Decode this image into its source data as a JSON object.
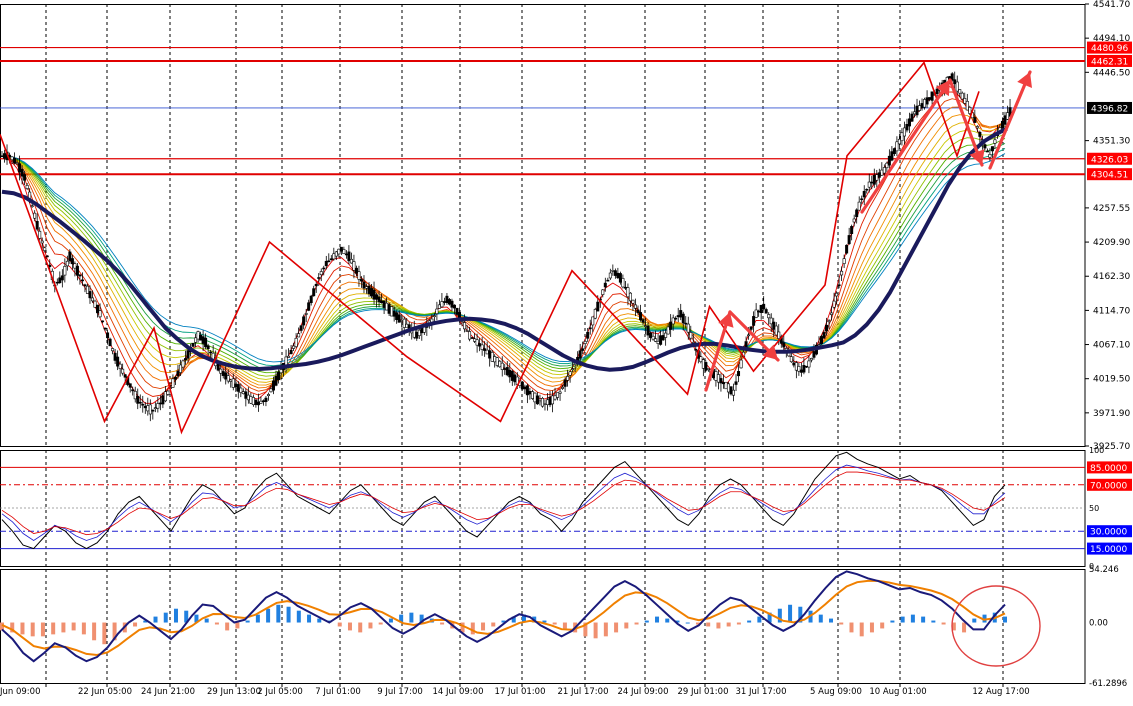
{
  "colors": {
    "background": "#ffffff",
    "plot_background": "#ffffff",
    "grid": "#000000",
    "candles": "#000000",
    "wma_fan_from": "#c00000",
    "wma_fan_to": "#00a040",
    "main_ma": "#1a1a5c",
    "red_annotations": "#e00000",
    "arrow": "#f04040",
    "level_lines": "#e00000",
    "current_price_line": "#3050d0",
    "macd_hist_pos": "#2080e0",
    "macd_hist_neg": "#f09070",
    "macd_line": "#1a1a7a",
    "signal_line": "#f08000",
    "oscillator_main": "#000000",
    "oscillator_blue": "#2020d0",
    "oscillator_red": "#e00000",
    "label_bg_red": "#ff0000",
    "label_bg_blue": "#0000ff",
    "label_bg_black": "#000000",
    "label_text": "#ffffff",
    "circle": "#e04040"
  },
  "chart_data": [
    {
      "panel": "price",
      "type": "candlestick",
      "ylim": [
        3925.7,
        4541.7
      ],
      "y_ticks": [
        "4541.70",
        "4494.10",
        "4446.50",
        "4351.30",
        "4257.55",
        "4209.90",
        "4162.30",
        "4114.70",
        "4067.10",
        "4019.50",
        "3971.90",
        "3925.70"
      ],
      "y_tick_values": [
        4541.7,
        4494.1,
        4446.5,
        4351.3,
        4257.55,
        4209.9,
        4162.3,
        4114.7,
        4067.1,
        4019.5,
        3971.9,
        3925.7
      ],
      "price_labels": [
        {
          "text": "4480.96",
          "value": 4480.96,
          "style": "red"
        },
        {
          "text": "4462.31",
          "value": 4462.31,
          "style": "red"
        },
        {
          "text": "4396.82",
          "value": 4396.82,
          "style": "black"
        },
        {
          "text": "4326.03",
          "value": 4326.03,
          "style": "red"
        },
        {
          "text": "4304.51",
          "value": 4304.51,
          "style": "red"
        }
      ],
      "horizontal_levels": [
        4480.96,
        4462.31,
        4326.03,
        4304.51
      ],
      "current_price": 4396.82,
      "close_path": [
        4330,
        4320,
        4300,
        4260,
        4220,
        4190,
        4150,
        4160,
        4190,
        4170,
        4150,
        4130,
        4110,
        4080,
        4050,
        4030,
        4010,
        3990,
        3980,
        3975,
        3985,
        4000,
        4020,
        4040,
        4060,
        4080,
        4070,
        4050,
        4030,
        4020,
        4010,
        4000,
        3990,
        3985,
        3990,
        4010,
        4030,
        4050,
        4070,
        4100,
        4130,
        4160,
        4180,
        4190,
        4200,
        4190,
        4170,
        4150,
        4140,
        4130,
        4120,
        4110,
        4100,
        4090,
        4080,
        4090,
        4100,
        4120,
        4130,
        4120,
        4100,
        4080,
        4070,
        4060,
        4050,
        4040,
        4030,
        4020,
        4010,
        4000,
        3990,
        3985,
        3990,
        4000,
        4020,
        4040,
        4060,
        4090,
        4120,
        4150,
        4170,
        4160,
        4140,
        4120,
        4100,
        4080,
        4070,
        4080,
        4100,
        4110,
        4090,
        4060,
        4040,
        4030,
        4020,
        4010,
        4000,
        4040,
        4080,
        4110,
        4120,
        4100,
        4080,
        4060,
        4040,
        4030,
        4040,
        4060,
        4080,
        4110,
        4150,
        4200,
        4240,
        4270,
        4290,
        4300,
        4310,
        4330,
        4350,
        4370,
        4390,
        4400,
        4410,
        4420,
        4430,
        4440,
        4420,
        4400,
        4380,
        4350,
        4330,
        4360,
        4380,
        4396.82
      ],
      "main_ma": [
        4280,
        4278,
        4272,
        4262,
        4250,
        4238,
        4225,
        4212,
        4198,
        4184,
        4168,
        4150,
        4130,
        4110,
        4090,
        4075,
        4062,
        4052,
        4045,
        4040,
        4036,
        4034,
        4033,
        4034,
        4036,
        4038,
        4040,
        4043,
        4047,
        4052,
        4058,
        4064,
        4070,
        4076,
        4082,
        4088,
        4093,
        4097,
        4100,
        4102,
        4103,
        4102,
        4100,
        4096,
        4090,
        4082,
        4072,
        4062,
        4052,
        4044,
        4038,
        4034,
        4032,
        4033,
        4036,
        4042,
        4049,
        4056,
        4062,
        4066,
        4068,
        4068,
        4066,
        4063,
        4060,
        4058,
        4057,
        4057,
        4058,
        4060,
        4063,
        4066,
        4070,
        4080,
        4095,
        4115,
        4140,
        4170,
        4200,
        4230,
        4260,
        4290,
        4315,
        4335,
        4350,
        4360,
        4368
      ],
      "x_labels": [
        "Jun 09:00",
        "22 Jun 05:00",
        "24 Jun 21:00",
        "29 Jun 13:00",
        "2 Jul 05:00",
        "7 Jul 01:00",
        "9 Jul 17:00",
        "14 Jul 09:00",
        "17 Jul 01:00",
        "21 Jul 17:00",
        "24 Jul 09:00",
        "29 Jul 01:00",
        "31 Jul 17:00",
        "5 Aug 09:00",
        "10 Aug 01:00",
        "12 Aug 17:00"
      ],
      "zigzag": [
        [
          0,
          4360
        ],
        [
          0.095,
          3960
        ],
        [
          0.14,
          4090
        ],
        [
          0.165,
          3945
        ],
        [
          0.245,
          4210
        ],
        [
          0.37,
          4050
        ],
        [
          0.455,
          3960
        ],
        [
          0.52,
          4170
        ],
        [
          0.625,
          3998
        ],
        [
          0.645,
          4120
        ],
        [
          0.685,
          4030
        ],
        [
          0.75,
          4150
        ],
        [
          0.77,
          4330
        ],
        [
          0.84,
          4460
        ],
        [
          0.87,
          4330
        ],
        [
          0.89,
          4420
        ]
      ]
    },
    {
      "panel": "oscillator",
      "type": "line",
      "ylim": [
        0,
        100
      ],
      "y_ticks": [
        "100",
        "50",
        "0"
      ],
      "y_tick_values": [
        100,
        50,
        0
      ],
      "level_labels": [
        {
          "text": "85.0000",
          "value": 85,
          "style": "red"
        },
        {
          "text": "70.0000",
          "value": 70,
          "style": "red"
        },
        {
          "text": "30.0000",
          "value": 30,
          "style": "blue"
        },
        {
          "text": "15.0000",
          "value": 15,
          "style": "blue"
        }
      ],
      "series": [
        {
          "values": [
            40,
            30,
            18,
            15,
            25,
            35,
            30,
            20,
            15,
            20,
            30,
            45,
            55,
            60,
            50,
            40,
            30,
            45,
            60,
            70,
            65,
            55,
            45,
            50,
            65,
            75,
            80,
            70,
            60,
            55,
            50,
            45,
            55,
            65,
            70,
            60,
            50,
            40,
            35,
            45,
            55,
            60,
            50,
            40,
            30,
            25,
            35,
            45,
            55,
            60,
            55,
            45,
            40,
            30,
            40,
            55,
            65,
            75,
            85,
            90,
            80,
            70,
            60,
            50,
            40,
            35,
            45,
            60,
            70,
            75,
            70,
            60,
            50,
            40,
            35,
            45,
            60,
            75,
            85,
            95,
            98,
            92,
            88,
            85,
            80,
            75,
            78,
            72,
            70,
            65,
            55,
            45,
            35,
            40,
            60,
            70
          ]
        },
        {
          "values": [
            45,
            38,
            28,
            22,
            28,
            35,
            32,
            26,
            22,
            25,
            32,
            42,
            50,
            55,
            50,
            44,
            38,
            45,
            55,
            63,
            62,
            56,
            50,
            52,
            60,
            68,
            72,
            68,
            62,
            58,
            54,
            50,
            55,
            61,
            64,
            60,
            53,
            46,
            42,
            46,
            52,
            56,
            52,
            46,
            40,
            36,
            40,
            46,
            52,
            56,
            54,
            48,
            44,
            40,
            44,
            52,
            60,
            68,
            76,
            80,
            76,
            70,
            63,
            56,
            49,
            44,
            48,
            56,
            63,
            68,
            66,
            60,
            54,
            48,
            44,
            48,
            56,
            66,
            75,
            83,
            87,
            85,
            82,
            80,
            77,
            74,
            75,
            72,
            70,
            66,
            60,
            52,
            45,
            45,
            55,
            63
          ]
        },
        {
          "values": [
            48,
            42,
            34,
            28,
            30,
            34,
            33,
            30,
            27,
            28,
            32,
            38,
            45,
            50,
            49,
            45,
            41,
            44,
            51,
            58,
            59,
            56,
            52,
            52,
            57,
            63,
            67,
            66,
            62,
            59,
            56,
            53,
            55,
            59,
            62,
            60,
            55,
            50,
            46,
            47,
            51,
            54,
            52,
            48,
            44,
            40,
            41,
            45,
            50,
            53,
            53,
            49,
            46,
            43,
            45,
            50,
            56,
            63,
            70,
            74,
            73,
            69,
            64,
            58,
            53,
            48,
            49,
            54,
            60,
            64,
            64,
            60,
            56,
            51,
            47,
            48,
            54,
            62,
            70,
            77,
            81,
            81,
            80,
            78,
            76,
            74,
            74,
            72,
            70,
            67,
            62,
            56,
            50,
            48,
            53,
            59
          ]
        }
      ]
    },
    {
      "panel": "macd",
      "type": "bar+line",
      "ylim": [
        -61.2896,
        54.246
      ],
      "y_ticks": [
        "54.246",
        "0.00",
        "-61.2896"
      ],
      "y_tick_values": [
        54.246,
        0,
        -61.2896
      ],
      "histogram": [
        -8,
        -10,
        -12,
        -14,
        -14,
        -12,
        -10,
        -8,
        -12,
        -18,
        -22,
        -18,
        -10,
        -4,
        2,
        6,
        10,
        14,
        12,
        8,
        4,
        -2,
        -8,
        -6,
        2,
        8,
        14,
        18,
        16,
        12,
        8,
        4,
        2,
        -4,
        -8,
        -10,
        -6,
        -2,
        4,
        8,
        10,
        8,
        4,
        -2,
        -6,
        -10,
        -12,
        -8,
        -4,
        2,
        6,
        8,
        6,
        2,
        -2,
        -6,
        -10,
        -14,
        -16,
        -14,
        -10,
        -6,
        -2,
        2,
        6,
        4,
        2,
        0,
        -2,
        -4,
        -6,
        -4,
        -2,
        2,
        6,
        10,
        14,
        18,
        16,
        12,
        8,
        4,
        -2,
        -10,
        -14,
        -10,
        -6,
        2,
        6,
        8,
        6,
        2,
        -2,
        -8,
        -10,
        4,
        8,
        10,
        6
      ]
    }
  ]
}
